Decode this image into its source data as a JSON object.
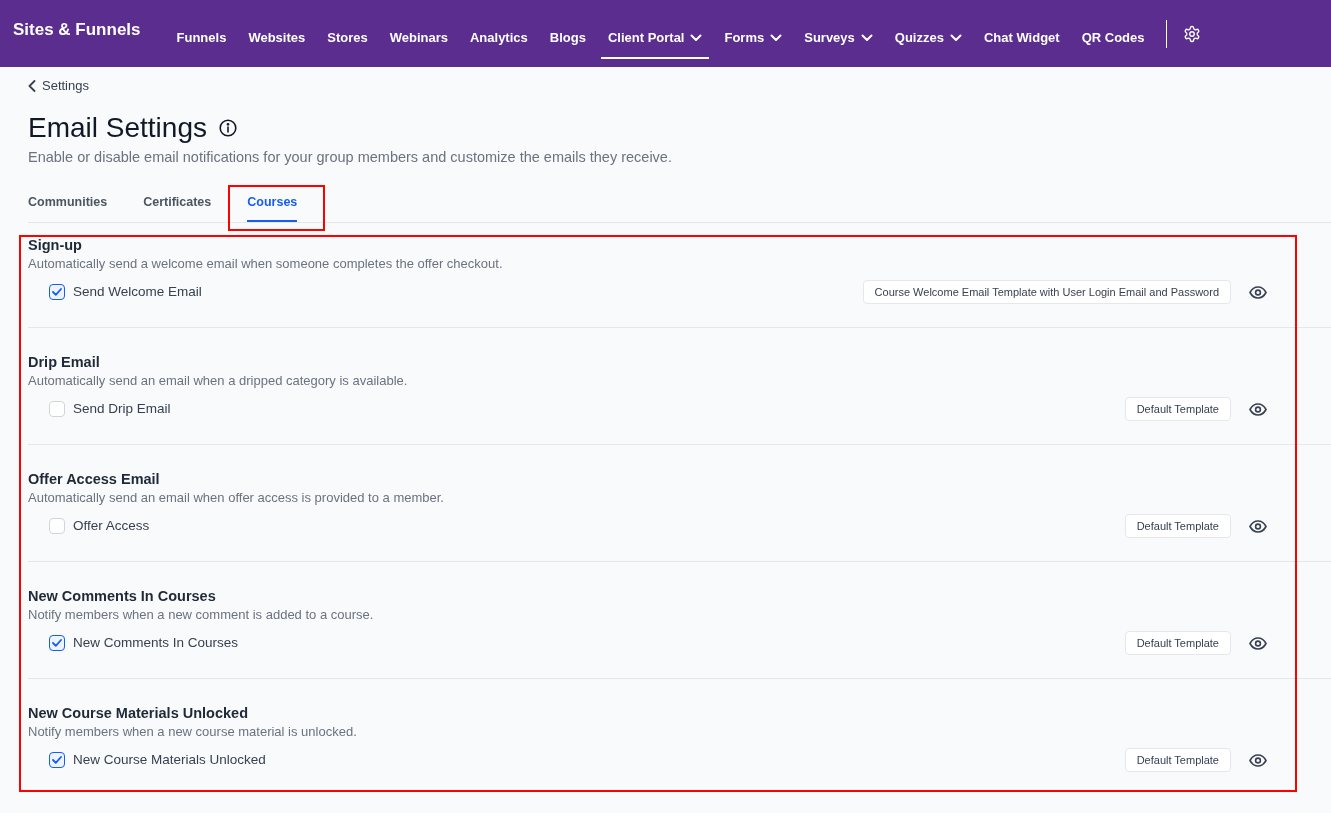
{
  "header": {
    "title": "Sites & Funnels",
    "nav": [
      {
        "label": "Funnels",
        "dropdown": false,
        "selected": false
      },
      {
        "label": "Websites",
        "dropdown": false,
        "selected": false
      },
      {
        "label": "Stores",
        "dropdown": false,
        "selected": false
      },
      {
        "label": "Webinars",
        "dropdown": false,
        "selected": false
      },
      {
        "label": "Analytics",
        "dropdown": false,
        "selected": false
      },
      {
        "label": "Blogs",
        "dropdown": false,
        "selected": false
      },
      {
        "label": "Client Portal",
        "dropdown": true,
        "selected": true
      },
      {
        "label": "Forms",
        "dropdown": true,
        "selected": false
      },
      {
        "label": "Surveys",
        "dropdown": true,
        "selected": false
      },
      {
        "label": "Quizzes",
        "dropdown": true,
        "selected": false
      },
      {
        "label": "Chat Widget",
        "dropdown": false,
        "selected": false
      },
      {
        "label": "QR Codes",
        "dropdown": false,
        "selected": false
      }
    ]
  },
  "back_link": "Settings",
  "page": {
    "title": "Email Settings",
    "subtitle": "Enable or disable email notifications for your group members and customize the emails they receive."
  },
  "tabs": [
    {
      "label": "Communities",
      "selected": false
    },
    {
      "label": "Certificates",
      "selected": false
    },
    {
      "label": "Courses",
      "selected": true
    }
  ],
  "sections": [
    {
      "title": "Sign-up",
      "description": "Automatically send a welcome email when someone completes the offer checkout.",
      "option": {
        "label": "Send Welcome Email",
        "checked": true
      },
      "template": "Course Welcome Email Template with User Login Email and Password"
    },
    {
      "title": "Drip Email",
      "description": "Automatically send an email when a dripped category is available.",
      "option": {
        "label": "Send Drip Email",
        "checked": false
      },
      "template": "Default Template"
    },
    {
      "title": "Offer Access Email",
      "description": "Automatically send an email when offer access is provided to a member.",
      "option": {
        "label": "Offer Access",
        "checked": false
      },
      "template": "Default Template"
    },
    {
      "title": "New Comments In Courses",
      "description": "Notify members when a new comment is added to a course.",
      "option": {
        "label": "New Comments In Courses",
        "checked": true
      },
      "template": "Default Template"
    },
    {
      "title": "New Course Materials Unlocked",
      "description": "Notify members when a new course material is unlocked.",
      "option": {
        "label": "New Course Materials Unlocked",
        "checked": true
      },
      "template": "Default Template"
    }
  ]
}
